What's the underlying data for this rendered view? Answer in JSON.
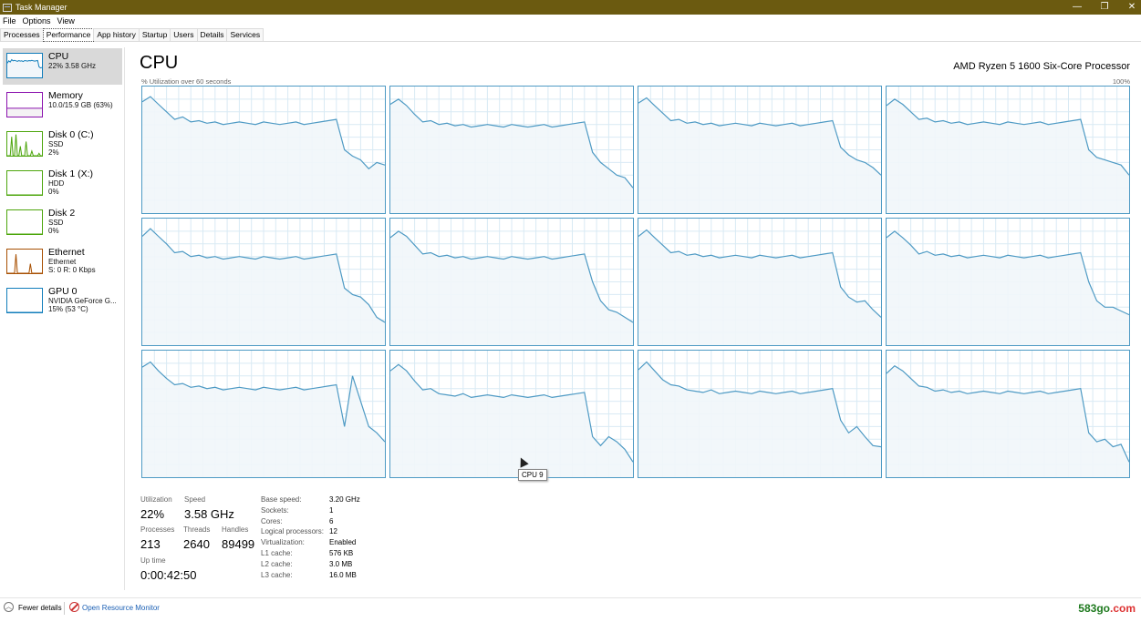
{
  "window": {
    "title": "Task Manager",
    "controls": {
      "minimize": "—",
      "restore": "❐",
      "close": "✕"
    }
  },
  "menu": [
    "File",
    "Options",
    "View"
  ],
  "tabs": [
    {
      "label": "Processes",
      "active": false
    },
    {
      "label": "Performance",
      "active": true
    },
    {
      "label": "App history",
      "active": false
    },
    {
      "label": "Startup",
      "active": false
    },
    {
      "label": "Users",
      "active": false
    },
    {
      "label": "Details",
      "active": false
    },
    {
      "label": "Services",
      "active": false
    }
  ],
  "sidebar": [
    {
      "name": "CPU",
      "lines": [
        "22% 3.58 GHz"
      ],
      "color": "#117dbb",
      "fill": "#f1f6fa",
      "selected": true,
      "graph": "cpu"
    },
    {
      "name": "Memory",
      "lines": [
        "10.0/15.9 GB (63%)"
      ],
      "color": "#8b12ae",
      "fill": "#f4f2f4",
      "selected": false,
      "graph": "memory"
    },
    {
      "name": "Disk 0 (C:)",
      "lines": [
        "SSD",
        "2%"
      ],
      "color": "#4da60c",
      "fill": "#eff4eb",
      "selected": false,
      "graph": "disk0"
    },
    {
      "name": "Disk 1 (X:)",
      "lines": [
        "HDD",
        "0%"
      ],
      "color": "#4da60c",
      "fill": "#eff4eb",
      "selected": false,
      "graph": "flat"
    },
    {
      "name": "Disk 2",
      "lines": [
        "SSD",
        "0%"
      ],
      "color": "#4da60c",
      "fill": "#eff4eb",
      "selected": false,
      "graph": "flat"
    },
    {
      "name": "Ethernet",
      "lines": [
        "Ethernet",
        "S: 0 R: 0 Kbps"
      ],
      "color": "#a74f01",
      "fill": "#fcf3eb",
      "selected": false,
      "graph": "ethernet"
    },
    {
      "name": "GPU 0",
      "lines": [
        "NVIDIA GeForce G...",
        "15% (53 °C)"
      ],
      "color": "#117dbb",
      "fill": "#f1f6fa",
      "selected": false,
      "graph": "flat"
    }
  ],
  "main": {
    "title": "CPU",
    "processor": "AMD Ryzen 5 1600 Six-Core Processor",
    "axis_left": "% Utilization over 60 seconds",
    "axis_right": "100%",
    "graph_color": "#4e9ac4",
    "graph_fill": "#f1f6fa",
    "grid_color": "#d9eaf4",
    "tooltip": "CPU 9"
  },
  "chart_data": {
    "type": "line",
    "ylim": [
      0,
      100
    ],
    "x": [
      0,
      2,
      4,
      6,
      8,
      10,
      12,
      14,
      16,
      18,
      20,
      22,
      24,
      26,
      28,
      30,
      32,
      34,
      36,
      38,
      40,
      42,
      44,
      46,
      48,
      50,
      52,
      54,
      56,
      58,
      60
    ],
    "series": [
      {
        "values": [
          88,
          92,
          86,
          80,
          74,
          76,
          72,
          73,
          71,
          72,
          70,
          71,
          72,
          71,
          70,
          72,
          71,
          70,
          71,
          72,
          70,
          71,
          72,
          73,
          74,
          50,
          45,
          42,
          35,
          40,
          38
        ]
      },
      {
        "values": [
          86,
          90,
          85,
          78,
          72,
          73,
          70,
          71,
          69,
          70,
          68,
          69,
          70,
          69,
          68,
          70,
          69,
          68,
          69,
          70,
          68,
          69,
          70,
          71,
          72,
          48,
          40,
          35,
          30,
          28,
          20
        ]
      },
      {
        "values": [
          87,
          91,
          85,
          79,
          73,
          74,
          71,
          72,
          70,
          71,
          69,
          70,
          71,
          70,
          69,
          71,
          70,
          69,
          70,
          71,
          69,
          70,
          71,
          72,
          73,
          52,
          46,
          42,
          40,
          36,
          30
        ]
      },
      {
        "values": [
          85,
          90,
          86,
          80,
          74,
          75,
          72,
          73,
          71,
          72,
          70,
          71,
          72,
          71,
          70,
          72,
          71,
          70,
          71,
          72,
          70,
          71,
          72,
          73,
          74,
          50,
          44,
          42,
          40,
          38,
          30
        ]
      },
      {
        "values": [
          86,
          92,
          86,
          80,
          73,
          74,
          70,
          71,
          69,
          70,
          68,
          69,
          70,
          69,
          68,
          70,
          69,
          68,
          69,
          70,
          68,
          69,
          70,
          71,
          72,
          45,
          40,
          38,
          32,
          22,
          18
        ]
      },
      {
        "values": [
          85,
          90,
          86,
          79,
          72,
          73,
          70,
          71,
          69,
          70,
          68,
          69,
          70,
          69,
          68,
          70,
          69,
          68,
          69,
          70,
          68,
          69,
          70,
          71,
          72,
          50,
          35,
          28,
          26,
          22,
          18
        ]
      },
      {
        "values": [
          86,
          91,
          85,
          79,
          73,
          74,
          71,
          72,
          70,
          71,
          69,
          70,
          71,
          70,
          69,
          71,
          70,
          69,
          70,
          71,
          69,
          70,
          71,
          72,
          73,
          46,
          38,
          34,
          35,
          28,
          22
        ]
      },
      {
        "values": [
          85,
          90,
          85,
          79,
          72,
          74,
          71,
          72,
          70,
          71,
          69,
          70,
          71,
          70,
          69,
          71,
          70,
          69,
          70,
          71,
          69,
          70,
          71,
          72,
          73,
          50,
          35,
          30,
          30,
          27,
          24
        ]
      },
      {
        "values": [
          87,
          91,
          84,
          78,
          73,
          74,
          71,
          72,
          70,
          71,
          69,
          70,
          71,
          70,
          69,
          71,
          70,
          69,
          70,
          71,
          69,
          70,
          71,
          72,
          73,
          40,
          80,
          60,
          40,
          35,
          28
        ]
      },
      {
        "values": [
          84,
          89,
          84,
          76,
          69,
          70,
          66,
          65,
          64,
          66,
          63,
          64,
          65,
          64,
          63,
          65,
          64,
          63,
          64,
          65,
          63,
          64,
          65,
          66,
          67,
          32,
          25,
          32,
          28,
          22,
          12
        ]
      },
      {
        "values": [
          85,
          91,
          84,
          77,
          73,
          72,
          69,
          68,
          67,
          69,
          66,
          67,
          68,
          67,
          66,
          68,
          67,
          66,
          67,
          68,
          66,
          67,
          68,
          69,
          70,
          45,
          35,
          40,
          32,
          25,
          24
        ]
      },
      {
        "values": [
          82,
          88,
          84,
          78,
          72,
          71,
          68,
          69,
          67,
          68,
          66,
          67,
          68,
          67,
          66,
          68,
          67,
          66,
          67,
          68,
          66,
          67,
          68,
          69,
          70,
          35,
          28,
          30,
          24,
          26,
          12
        ]
      }
    ]
  },
  "stats": {
    "utilization_label": "Utilization",
    "utilization": "22%",
    "speed_label": "Speed",
    "speed": "3.58 GHz",
    "processes_label": "Processes",
    "processes": "213",
    "threads_label": "Threads",
    "threads": "2640",
    "handles_label": "Handles",
    "handles": "89499",
    "uptime_label": "Up time",
    "uptime": "0:00:42:50"
  },
  "info": [
    {
      "label": "Base speed:",
      "value": "3.20 GHz"
    },
    {
      "label": "Sockets:",
      "value": "1"
    },
    {
      "label": "Cores:",
      "value": "6"
    },
    {
      "label": "Logical processors:",
      "value": "12"
    },
    {
      "label": "Virtualization:",
      "value": "Enabled"
    },
    {
      "label": "L1 cache:",
      "value": "576 KB"
    },
    {
      "label": "L2 cache:",
      "value": "3.0 MB"
    },
    {
      "label": "L3 cache:",
      "value": "16.0 MB"
    }
  ],
  "footer": {
    "fewer_details": "Fewer details",
    "open_resource_monitor": "Open Resource Monitor",
    "watermark_main": "583go",
    "watermark_tld": ".com"
  }
}
